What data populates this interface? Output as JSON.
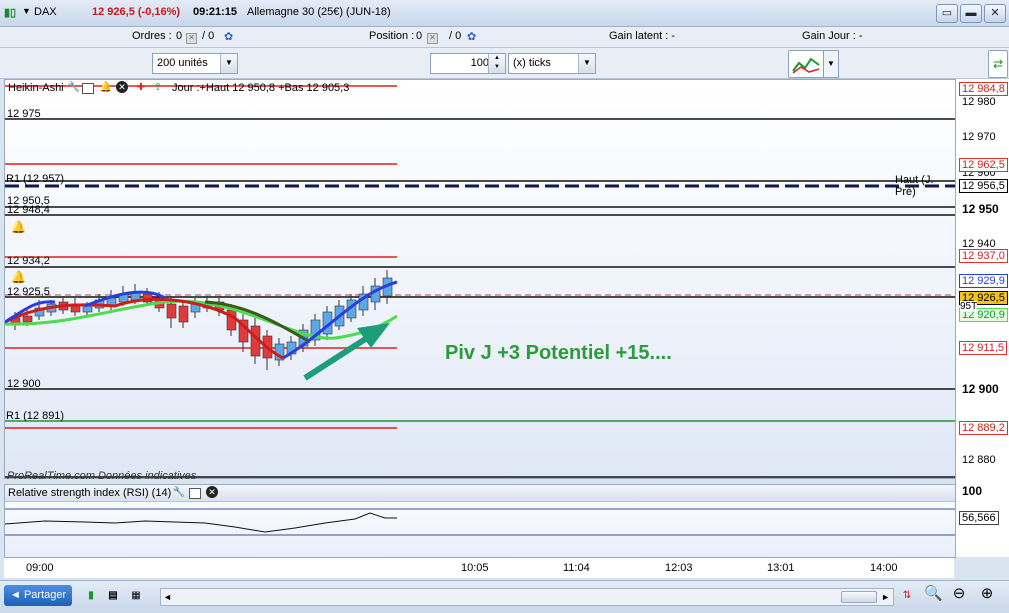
{
  "header": {
    "symbol": "DAX",
    "price_change": "12 926,5 (-0,16%)",
    "time": "09:21:15",
    "instrument": "Allemagne 30 (25€) (JUN-18)"
  },
  "info": {
    "orders_label": "Ordres :",
    "orders_value": "0",
    "orders_sep": "/ 0",
    "position_label": "Position :",
    "position_value": "0",
    "position_sep": "/ 0",
    "gain_latent": "Gain latent :  -",
    "gain_jour": "Gain Jour :  -"
  },
  "controls": {
    "units": "200 unités",
    "ticks_value": "100",
    "ticks_unit": "(x) ticks"
  },
  "chart": {
    "indicator_title": "Heikin-Ashi",
    "day_info": "Jour :+Haut 12 950,8 +Bas 12 905,3",
    "annotation": "Piv J +3 Potentiel +15....",
    "level_labels": [
      "12 975",
      "R1 (12 957)",
      "12 950,5",
      "12 948,4",
      "12 934,2",
      "12 925,5",
      "12 900",
      "R1 (12 891)"
    ],
    "haut_label": "Haut (J. Pré)",
    "watermark": "ProRealTime.com Données indicatives"
  },
  "price_axis": {
    "boxes": [
      "12 984,8",
      "12 962,5",
      "12 956,5",
      "12 937,0",
      "12 929,9",
      "12 926,5",
      "12 920,9",
      "12 911,5",
      "12 889,2"
    ],
    "ticks": [
      "12 980",
      "12 970",
      "12 960",
      "12 950",
      "12 940",
      "12 900",
      "12 880"
    ],
    "volume_label": "95T"
  },
  "rsi": {
    "title": "Relative strength index (RSI) (14)",
    "axis_top": "100",
    "value": "56,566"
  },
  "time_axis": [
    "09:00",
    "10:05",
    "11:04",
    "12:03",
    "13:01",
    "14:00"
  ],
  "bottom": {
    "share_label": "Partager"
  },
  "colors": {
    "price_up": "#5aa9e6",
    "price_down": "#e03a3a",
    "annotation": "#2e9a3a",
    "ma_blue": "#2a3ee0",
    "ma_green": "#4ddc4d"
  }
}
